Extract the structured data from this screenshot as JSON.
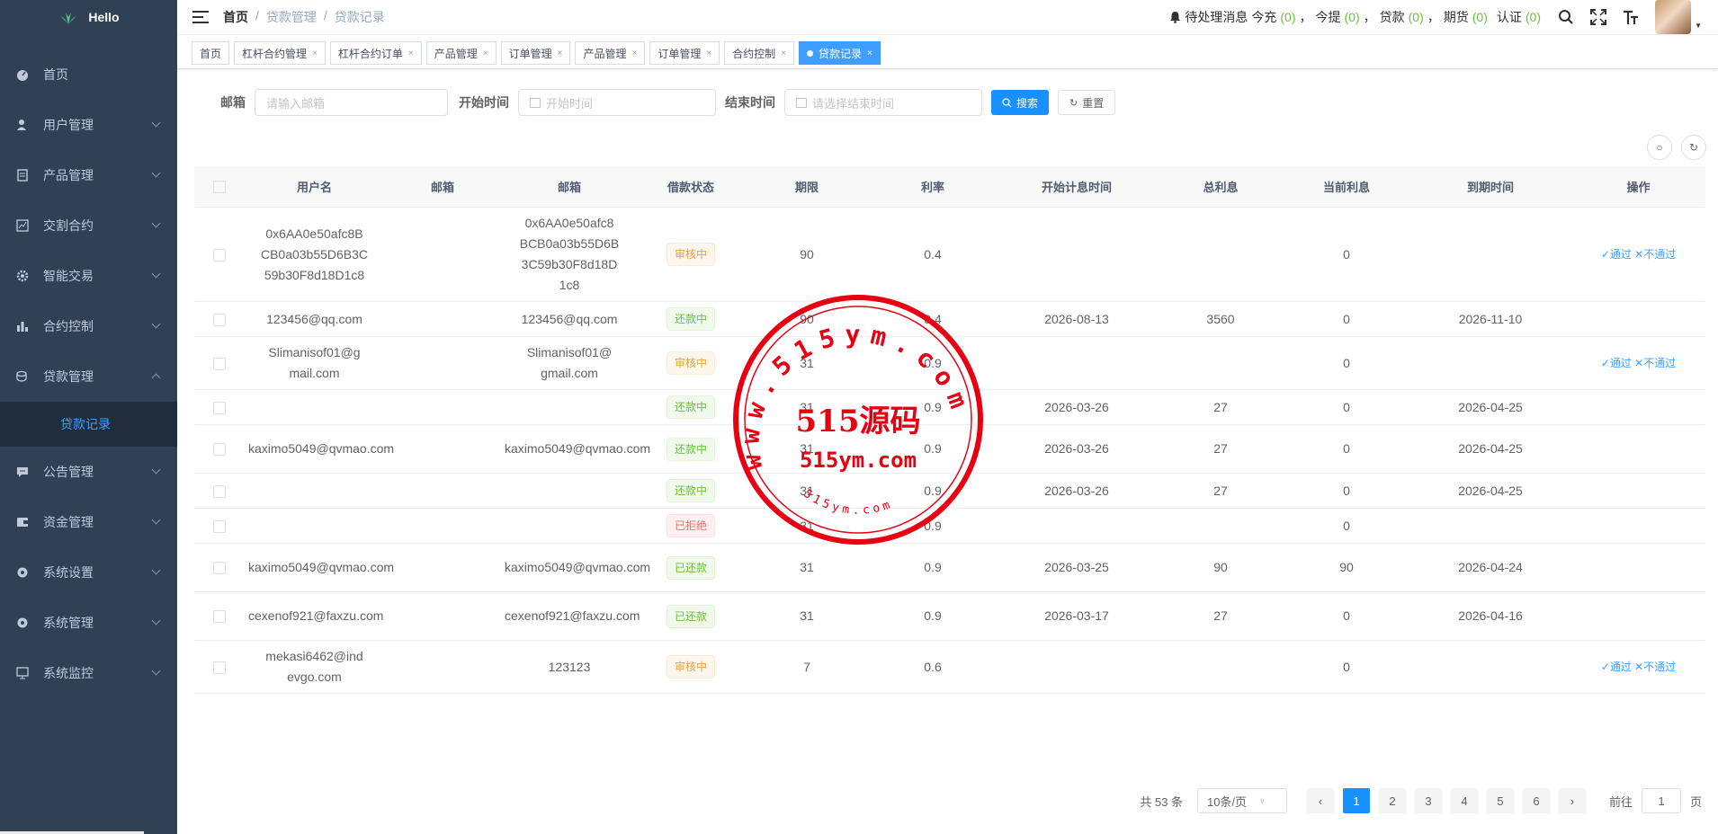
{
  "app": {
    "name": "Hello"
  },
  "sidebar": {
    "items": [
      {
        "label": "首页",
        "icon": "dashboard-icon",
        "expandable": false
      },
      {
        "label": "用户管理",
        "icon": "user-icon",
        "expandable": true
      },
      {
        "label": "产品管理",
        "icon": "document-icon",
        "expandable": true
      },
      {
        "label": "交割合约",
        "icon": "chart-edit-icon",
        "expandable": true
      },
      {
        "label": "智能交易",
        "icon": "gear-icon",
        "expandable": true
      },
      {
        "label": "合约控制",
        "icon": "bar-chart-icon",
        "expandable": true
      },
      {
        "label": "贷款管理",
        "icon": "money-icon",
        "expandable": true,
        "open": true
      },
      {
        "label": "公告管理",
        "icon": "message-icon",
        "expandable": true
      },
      {
        "label": "资金管理",
        "icon": "wallet-icon",
        "expandable": true
      },
      {
        "label": "系统设置",
        "icon": "settings-icon",
        "expandable": true
      },
      {
        "label": "系统管理",
        "icon": "settings-icon",
        "expandable": true
      },
      {
        "label": "系统监控",
        "icon": "monitor-icon",
        "expandable": true
      }
    ],
    "submenu_active": "贷款记录"
  },
  "header": {
    "breadcrumb": [
      "首页",
      "贷款管理",
      "贷款记录"
    ],
    "notice": {
      "label": "待处理消息",
      "today_label": "今充",
      "today_count": "(0)",
      "withdraw_label": "今提",
      "withdraw_count": "(0)",
      "loan_label": "贷款",
      "loan_count": "(0)",
      "futures_label": "期货",
      "futures_count": "(0)",
      "auth_label": "认证",
      "auth_count": "(0)",
      "sep": "，"
    }
  },
  "tags": [
    {
      "label": "首页",
      "closable": false
    },
    {
      "label": "杠杆合约管理",
      "closable": true
    },
    {
      "label": "杠杆合约订单",
      "closable": true
    },
    {
      "label": "产品管理",
      "closable": true
    },
    {
      "label": "订单管理",
      "closable": true
    },
    {
      "label": "产品管理",
      "closable": true
    },
    {
      "label": "订单管理",
      "closable": true
    },
    {
      "label": "合约控制",
      "closable": true
    },
    {
      "label": "贷款记录",
      "closable": true,
      "active": true
    }
  ],
  "search": {
    "email_label": "邮箱",
    "email_placeholder": "请输入邮箱",
    "start_label": "开始时间",
    "start_placeholder": "开始时间",
    "end_label": "结束时间",
    "end_placeholder": "请选择结束时间",
    "search_btn": "搜索",
    "reset_btn": "重置"
  },
  "table": {
    "columns": [
      "用户名",
      "邮箱",
      "邮箱",
      "借款状态",
      "期限",
      "利率",
      "开始计息时间",
      "总利息",
      "当前利息",
      "到期时间",
      "操作"
    ],
    "approve": "✓通过",
    "reject": "✕不通过",
    "rows": [
      {
        "username": "0x6AA0e50afc8BCB0a03b55D6B3C59b30F8d18D1c8",
        "email1": "",
        "email2": "0x6AA0e50afc8BCB0a03b55D6B3C59b30F8d18D1c8",
        "status": "审核中",
        "status_type": "warn",
        "term": "90",
        "rate": "0.4",
        "start": "",
        "total": "",
        "current": "0",
        "due": "",
        "actions": true
      },
      {
        "username": "123456@qq.com",
        "email1": "",
        "email2": "123456@qq.com",
        "status": "还款中",
        "status_type": "ok",
        "term": "90",
        "rate": "0.4",
        "start": "2026-08-13",
        "total": "3560",
        "current": "0",
        "due": "2026-11-10",
        "actions": false
      },
      {
        "username": "Slimanisof01@gmail.com",
        "email1": "",
        "email2": "Slimanisof01@gmail.com",
        "status": "审核中",
        "status_type": "warn",
        "term": "31",
        "rate": "0.9",
        "start": "",
        "total": "",
        "current": "0",
        "due": "",
        "actions": true
      },
      {
        "username": "",
        "email1": "",
        "email2": "",
        "status": "还款中",
        "status_type": "ok",
        "term": "31",
        "rate": "0.9",
        "start": "2026-03-26",
        "total": "27",
        "current": "0",
        "due": "2026-04-25",
        "actions": false
      },
      {
        "username": "kaximo5049@qvmao.com",
        "email1": "",
        "email2": "kaximo5049@qvmao.com",
        "status": "还款中",
        "status_type": "ok",
        "term": "31",
        "rate": "0.9",
        "start": "2026-03-26",
        "total": "27",
        "current": "0",
        "due": "2026-04-25",
        "actions": false
      },
      {
        "username": "",
        "email1": "",
        "email2": "",
        "status": "还款中",
        "status_type": "ok",
        "term": "31",
        "rate": "0.9",
        "start": "2026-03-26",
        "total": "27",
        "current": "0",
        "due": "2026-04-25",
        "actions": false
      },
      {
        "username": "",
        "email1": "",
        "email2": "",
        "status": "已拒绝",
        "status_type": "err",
        "term": "31",
        "rate": "0.9",
        "start": "",
        "total": "",
        "current": "0",
        "due": "",
        "actions": false
      },
      {
        "username": "kaximo5049@qvmao.com",
        "email1": "",
        "email2": "kaximo5049@qvmao.com",
        "status": "已还款",
        "status_type": "ok",
        "term": "31",
        "rate": "0.9",
        "start": "2026-03-25",
        "total": "90",
        "current": "90",
        "due": "2026-04-24",
        "actions": false
      },
      {
        "username": "cexenof921@faxzu.com",
        "email1": "",
        "email2": "cexenof921@faxzu.com",
        "status": "已还款",
        "status_type": "ok",
        "term": "31",
        "rate": "0.9",
        "start": "2026-03-17",
        "total": "27",
        "current": "0",
        "due": "2026-04-16",
        "actions": false
      },
      {
        "username": "mekasi6462@indevgo.com",
        "email1": "",
        "email2": "123123",
        "status": "审核中",
        "status_type": "warn",
        "term": "7",
        "rate": "0.6",
        "start": "",
        "total": "",
        "current": "0",
        "due": "",
        "actions": true
      }
    ]
  },
  "pagination": {
    "total": "共 53 条",
    "page_size": "10条/页",
    "pages": [
      "1",
      "2",
      "3",
      "4",
      "5",
      "6"
    ],
    "current": "1",
    "goto_label": "前往",
    "goto_value": "1",
    "page_suffix": "页"
  },
  "watermark": {
    "ring_text": "www.515ym.com",
    "main": "515源码",
    "sub": "515ym.com",
    "small": "515ym.com",
    "color": "#e60012"
  },
  "colors": {
    "sidebar": "#304156",
    "accent": "#1890ff",
    "success": "#67c23a",
    "warning": "#e6a23c",
    "danger": "#f56c6c"
  }
}
